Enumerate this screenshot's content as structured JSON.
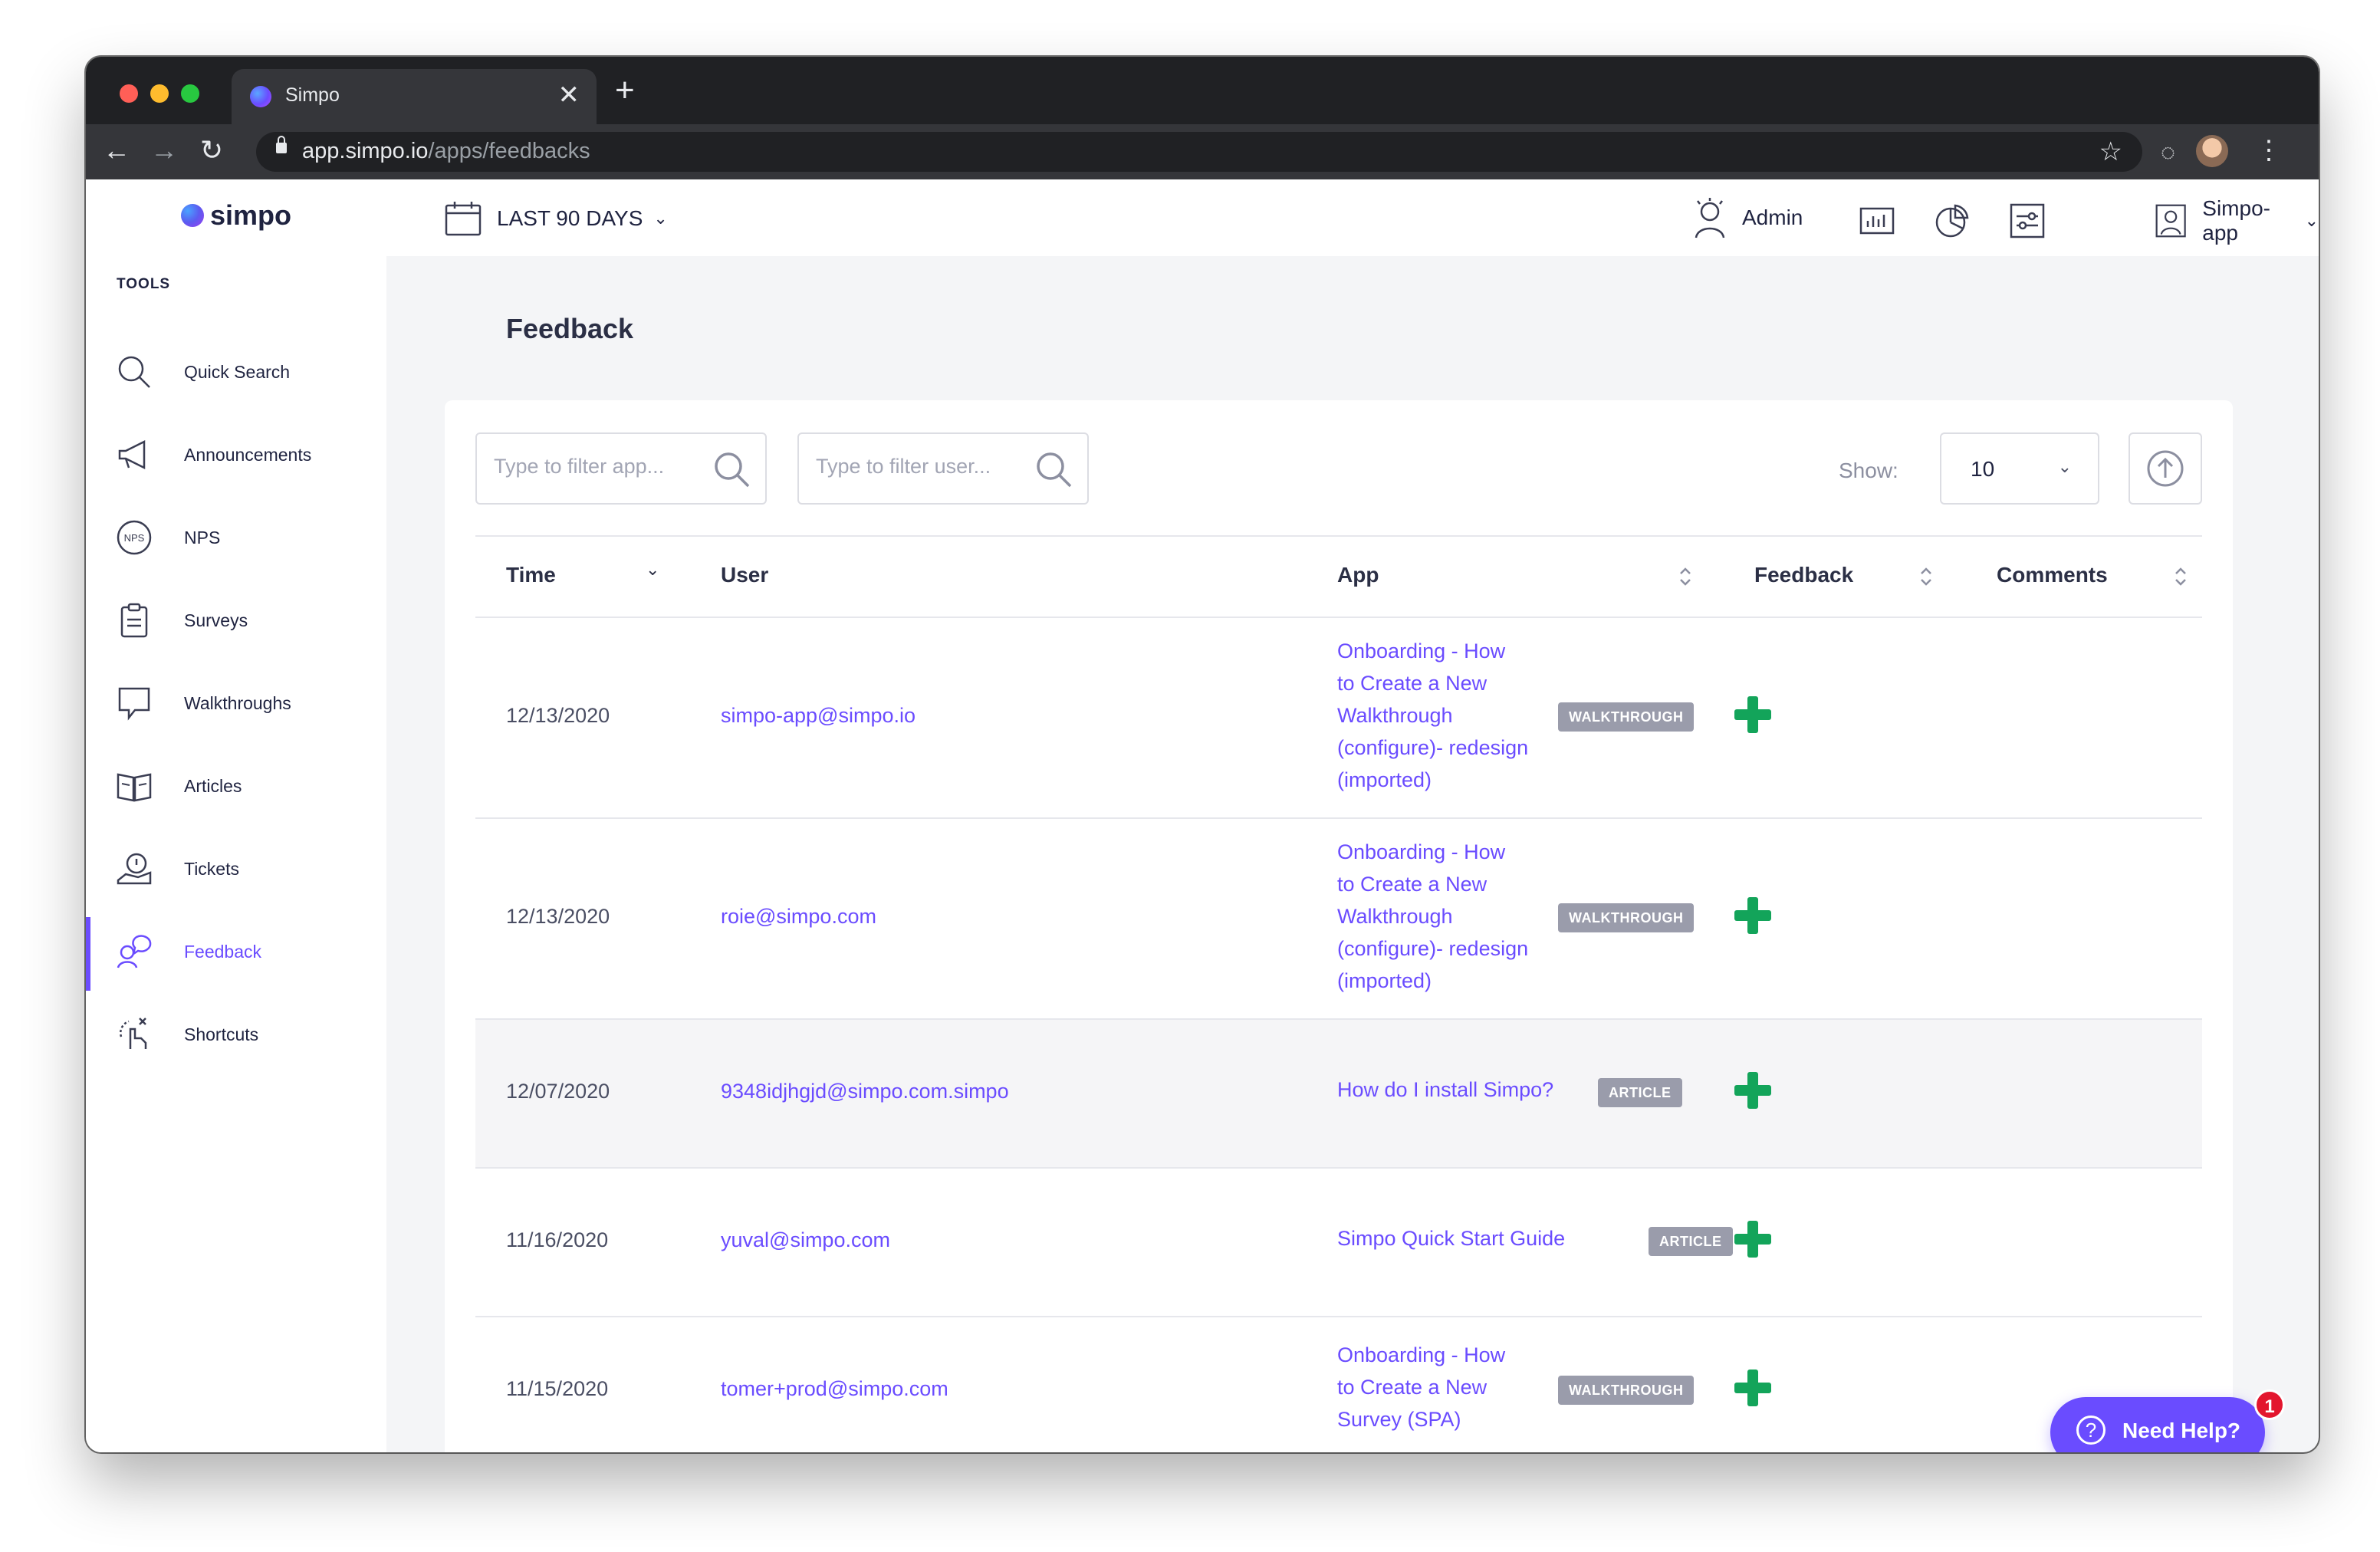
{
  "browser": {
    "tab_title": "Simpo",
    "url_host": "app.simpo.io",
    "url_path": "/apps/feedbacks",
    "new_tab_label": "+",
    "close_tab_label": "✕"
  },
  "app": {
    "logo_text": "simpo",
    "accent_color": "#6a4cff",
    "link_color": "#6a4cff",
    "plus_color": "#13a45a"
  },
  "sidebar": {
    "section_label": "TOOLS",
    "items": [
      {
        "label": "Quick Search",
        "icon": "search-icon"
      },
      {
        "label": "Announcements",
        "icon": "megaphone-icon"
      },
      {
        "label": "NPS",
        "icon": "nps-icon"
      },
      {
        "label": "Surveys",
        "icon": "clipboard-icon"
      },
      {
        "label": "Walkthroughs",
        "icon": "speech-bubble-icon"
      },
      {
        "label": "Articles",
        "icon": "book-icon"
      },
      {
        "label": "Tickets",
        "icon": "ticket-icon"
      },
      {
        "label": "Feedback",
        "icon": "feedback-icon",
        "active": true
      },
      {
        "label": "Shortcuts",
        "icon": "shortcut-icon"
      }
    ]
  },
  "topbar": {
    "date_range": "LAST 90 DAYS",
    "admin_label": "Admin",
    "account_label": "Simpo-app"
  },
  "page": {
    "title": "Feedback"
  },
  "filters": {
    "app_placeholder": "Type to filter app...",
    "user_placeholder": "Type to filter user...",
    "show_label": "Show:",
    "show_value": "10"
  },
  "table": {
    "columns": [
      "Time",
      "User",
      "App",
      "Feedback",
      "Comments"
    ],
    "rows": [
      {
        "time": "12/13/2020",
        "user": "simpo-app@simpo.io",
        "app": [
          "Onboarding - How",
          "to Create a New",
          "Walkthrough",
          "(configure)- redesign",
          "(imported)"
        ],
        "type": "WALKTHROUGH",
        "feedback": "positive",
        "comments": ""
      },
      {
        "time": "12/13/2020",
        "user": "roie@simpo.com",
        "app": [
          "Onboarding - How",
          "to Create a New",
          "Walkthrough",
          "(configure)- redesign",
          "(imported)"
        ],
        "type": "WALKTHROUGH",
        "feedback": "positive",
        "comments": ""
      },
      {
        "time": "12/07/2020",
        "user": "9348idjhgjd@simpo.com.simpo",
        "app": [
          "How do I install Simpo?"
        ],
        "type": "ARTICLE",
        "feedback": "positive",
        "comments": ""
      },
      {
        "time": "11/16/2020",
        "user": "yuval@simpo.com",
        "app": [
          "Simpo Quick Start Guide"
        ],
        "type": "ARTICLE",
        "feedback": "positive",
        "comments": ""
      },
      {
        "time": "11/15/2020",
        "user": "tomer+prod@simpo.com",
        "app": [
          "Onboarding - How",
          "to Create a New",
          "Survey (SPA)"
        ],
        "type": "WALKTHROUGH",
        "feedback": "positive",
        "comments": ""
      }
    ]
  },
  "help": {
    "label": "Need Help?",
    "badge_count": "1"
  }
}
